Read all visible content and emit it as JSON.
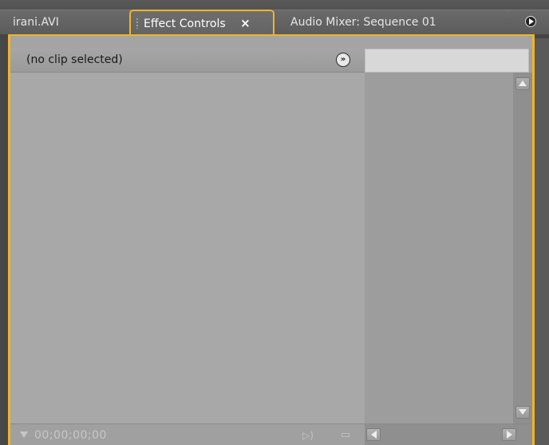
{
  "tabs": [
    {
      "label": "irani.AVI",
      "active": false
    },
    {
      "label": "Effect Controls",
      "active": true,
      "close_glyph": "×"
    },
    {
      "label": "Audio Mixer: Sequence 01",
      "active": false
    }
  ],
  "panel_menu_icon": "panel-menu-icon",
  "effect_controls": {
    "clip_label": "(no clip selected)",
    "toggle_glyph": "»",
    "timecode": "00;00;00;00",
    "footer_icons": [
      "playhead-icon",
      "play-audio-icon",
      "export-icon"
    ]
  },
  "colors": {
    "accent": "#f0b428",
    "panel_bg": "#a8a8a8",
    "timeline_bg": "#9d9d9d"
  }
}
